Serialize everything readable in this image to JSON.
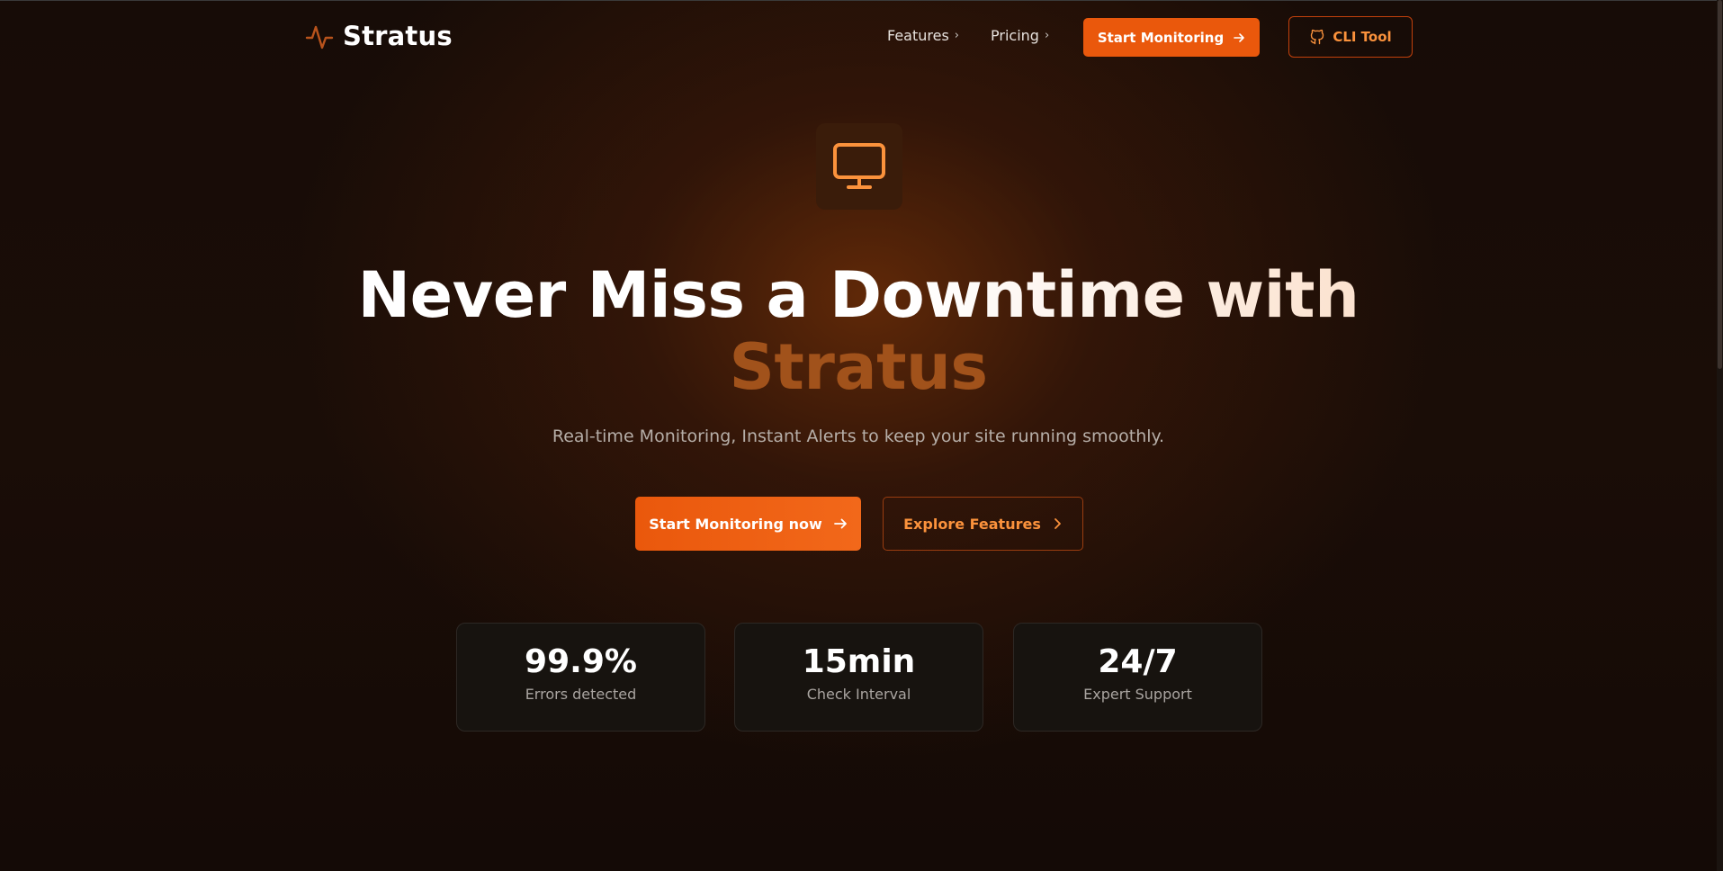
{
  "nav": {
    "brand": "Stratus",
    "links": [
      {
        "label": "Features"
      },
      {
        "label": "Pricing"
      }
    ],
    "cta_primary": "Start Monitoring",
    "cta_secondary": "CLI Tool"
  },
  "hero": {
    "icon": "monitor-icon",
    "headline_line1": "Never Miss a Downtime with",
    "headline_line2": "Stratus",
    "subtitle": "Real-time Monitoring, Instant Alerts to keep your site running smoothly.",
    "primary_button": "Start Monitoring now",
    "secondary_button": "Explore Features"
  },
  "stats": [
    {
      "value": "99.9%",
      "label": "Errors detected"
    },
    {
      "value": "15min",
      "label": "Check Interval"
    },
    {
      "value": "24/7",
      "label": "Expert Support"
    }
  ],
  "colors": {
    "accent": "#ea580c",
    "accent_light": "#fb923c",
    "brand_word": "#a1521b",
    "background": "#140b06"
  }
}
